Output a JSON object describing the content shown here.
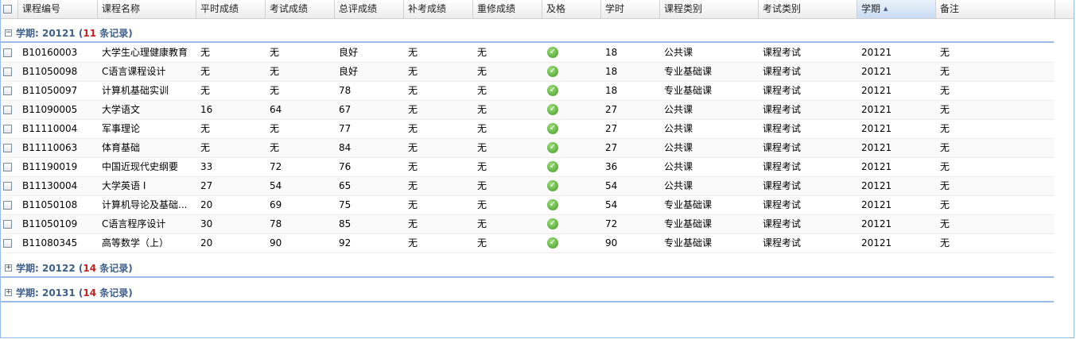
{
  "columns": [
    {
      "label": ""
    },
    {
      "label": "课程编号"
    },
    {
      "label": "课程名称"
    },
    {
      "label": "平时成绩"
    },
    {
      "label": "考试成绩"
    },
    {
      "label": "总评成绩"
    },
    {
      "label": "补考成绩"
    },
    {
      "label": "重修成绩"
    },
    {
      "label": "及格"
    },
    {
      "label": "学时"
    },
    {
      "label": "课程类别"
    },
    {
      "label": "考试类别"
    },
    {
      "label": "学期"
    },
    {
      "label": "备注"
    }
  ],
  "sort_icon": "sort-ascending-icon",
  "groups": [
    {
      "prefix": "学期: ",
      "term": "20121",
      "open": " (",
      "count": "11",
      "suffix": " 条记录)",
      "expanded": true
    },
    {
      "prefix": "学期: ",
      "term": "20122",
      "open": " (",
      "count": "14",
      "suffix": " 条记录)",
      "expanded": false
    },
    {
      "prefix": "学期: ",
      "term": "20131",
      "open": " (",
      "count": "14",
      "suffix": " 条记录)",
      "expanded": false
    }
  ],
  "toggle_symbols": {
    "expanded": "−",
    "collapsed": "+"
  },
  "rows": [
    {
      "code": "B10160003",
      "name": "大学生心理健康教育",
      "usual": "无",
      "exam": "无",
      "total": "良好",
      "makeup": "无",
      "retake": "无",
      "pass": true,
      "hours": "18",
      "ctype": "公共课",
      "etype": "课程考试",
      "term": "20121",
      "note": "无"
    },
    {
      "code": "B11050098",
      "name": "C语言课程设计",
      "usual": "无",
      "exam": "无",
      "total": "良好",
      "makeup": "无",
      "retake": "无",
      "pass": true,
      "hours": "18",
      "ctype": "专业基础课",
      "etype": "课程考试",
      "term": "20121",
      "note": "无"
    },
    {
      "code": "B11050097",
      "name": "计算机基础实训",
      "usual": "无",
      "exam": "无",
      "total": "78",
      "makeup": "无",
      "retake": "无",
      "pass": true,
      "hours": "18",
      "ctype": "专业基础课",
      "etype": "课程考试",
      "term": "20121",
      "note": "无"
    },
    {
      "code": "B11090005",
      "name": "大学语文",
      "usual": "16",
      "exam": "64",
      "total": "67",
      "makeup": "无",
      "retake": "无",
      "pass": true,
      "hours": "27",
      "ctype": "公共课",
      "etype": "课程考试",
      "term": "20121",
      "note": "无"
    },
    {
      "code": "B11110004",
      "name": "军事理论",
      "usual": "无",
      "exam": "无",
      "total": "77",
      "makeup": "无",
      "retake": "无",
      "pass": true,
      "hours": "27",
      "ctype": "公共课",
      "etype": "课程考试",
      "term": "20121",
      "note": "无"
    },
    {
      "code": "B11110063",
      "name": "体育基础",
      "usual": "无",
      "exam": "无",
      "total": "84",
      "makeup": "无",
      "retake": "无",
      "pass": true,
      "hours": "27",
      "ctype": "公共课",
      "etype": "课程考试",
      "term": "20121",
      "note": "无"
    },
    {
      "code": "B11190019",
      "name": "中国近现代史纲要",
      "usual": "33",
      "exam": "72",
      "total": "76",
      "makeup": "无",
      "retake": "无",
      "pass": true,
      "hours": "36",
      "ctype": "公共课",
      "etype": "课程考试",
      "term": "20121",
      "note": "无"
    },
    {
      "code": "B11130004",
      "name": "大学英语 I",
      "usual": "27",
      "exam": "54",
      "total": "65",
      "makeup": "无",
      "retake": "无",
      "pass": true,
      "hours": "54",
      "ctype": "公共课",
      "etype": "课程考试",
      "term": "20121",
      "note": "无"
    },
    {
      "code": "B11050108",
      "name": "计算机导论及基础...",
      "usual": "20",
      "exam": "69",
      "total": "75",
      "makeup": "无",
      "retake": "无",
      "pass": true,
      "hours": "54",
      "ctype": "专业基础课",
      "etype": "课程考试",
      "term": "20121",
      "note": "无"
    },
    {
      "code": "B11050109",
      "name": "C语言程序设计",
      "usual": "30",
      "exam": "78",
      "total": "85",
      "makeup": "无",
      "retake": "无",
      "pass": true,
      "hours": "72",
      "ctype": "专业基础课",
      "etype": "课程考试",
      "term": "20121",
      "note": "无"
    },
    {
      "code": "B11080345",
      "name": "高等数学（上）",
      "usual": "20",
      "exam": "90",
      "total": "92",
      "makeup": "无",
      "retake": "无",
      "pass": true,
      "hours": "90",
      "ctype": "专业基础课",
      "etype": "课程考试",
      "term": "20121",
      "note": "无"
    }
  ],
  "pass_icon": "check-circle-icon",
  "pass_color": "#4caf2e",
  "accent_color": "#99bbe8",
  "group_text_color": "#3d5f8a",
  "count_color": "#c02020"
}
